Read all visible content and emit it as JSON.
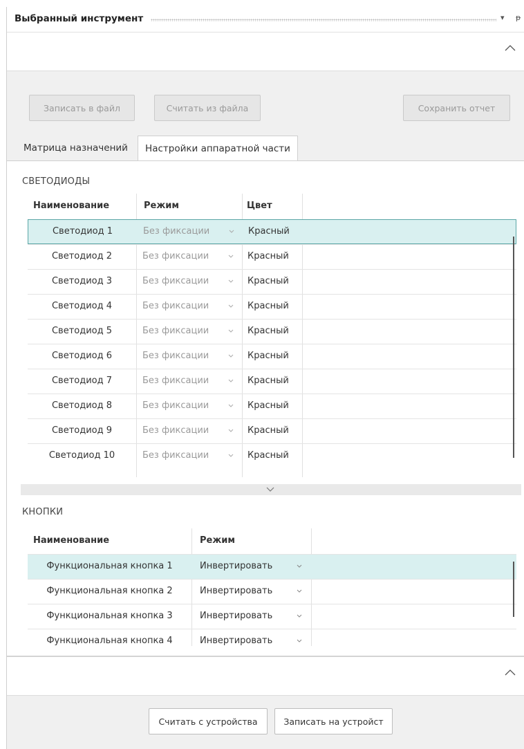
{
  "panel": {
    "title": "Выбранный инструмент",
    "dropdown_glyph": "▾",
    "pin_glyph": "ᵽ"
  },
  "top_toolbar": {
    "write_file_label": "Записать в файл",
    "read_file_label": "Считать из файла",
    "save_report_label": "Сохранить отчет"
  },
  "tabs": [
    {
      "label": "Матрица назначений",
      "selected": false
    },
    {
      "label": "Настройки аппаратной части",
      "selected": true
    }
  ],
  "leds": {
    "section_title": "СВЕТОДИОДЫ",
    "columns": [
      "Наименование",
      "Режим",
      "Цвет"
    ],
    "rows": [
      {
        "name": "Светодиод 1",
        "mode": "Без фиксации",
        "color": "Красный"
      },
      {
        "name": "Светодиод 2",
        "mode": "Без фиксации",
        "color": "Красный"
      },
      {
        "name": "Светодиод 3",
        "mode": "Без фиксации",
        "color": "Красный"
      },
      {
        "name": "Светодиод 4",
        "mode": "Без фиксации",
        "color": "Красный"
      },
      {
        "name": "Светодиод 5",
        "mode": "Без фиксации",
        "color": "Красный"
      },
      {
        "name": "Светодиод 6",
        "mode": "Без фиксации",
        "color": "Красный"
      },
      {
        "name": "Светодиод 7",
        "mode": "Без фиксации",
        "color": "Красный"
      },
      {
        "name": "Светодиод 8",
        "mode": "Без фиксации",
        "color": "Красный"
      },
      {
        "name": "Светодиод 9",
        "mode": "Без фиксации",
        "color": "Красный"
      },
      {
        "name": "Светодиод 10",
        "mode": "Без фиксации",
        "color": "Красный"
      }
    ]
  },
  "buttons_section": {
    "section_title": "КНОПКИ",
    "columns": [
      "Наименование",
      "Режим"
    ],
    "rows": [
      {
        "name": "Функциональная кнопка 1",
        "mode": "Инвертировать"
      },
      {
        "name": "Функциональная кнопка 2",
        "mode": "Инвертировать"
      },
      {
        "name": "Функциональная кнопка 3",
        "mode": "Инвертировать"
      },
      {
        "name": "Функциональная кнопка 4",
        "mode": "Инвертировать"
      }
    ]
  },
  "bottom_toolbar": {
    "read_device_label": "Считать с устройства",
    "write_device_label": "Записать на устройст"
  },
  "colors": {
    "selected_row": "#d9f0f0",
    "focus_border": "#5aa6a6",
    "toolbar_bg": "#f0f0f0"
  }
}
